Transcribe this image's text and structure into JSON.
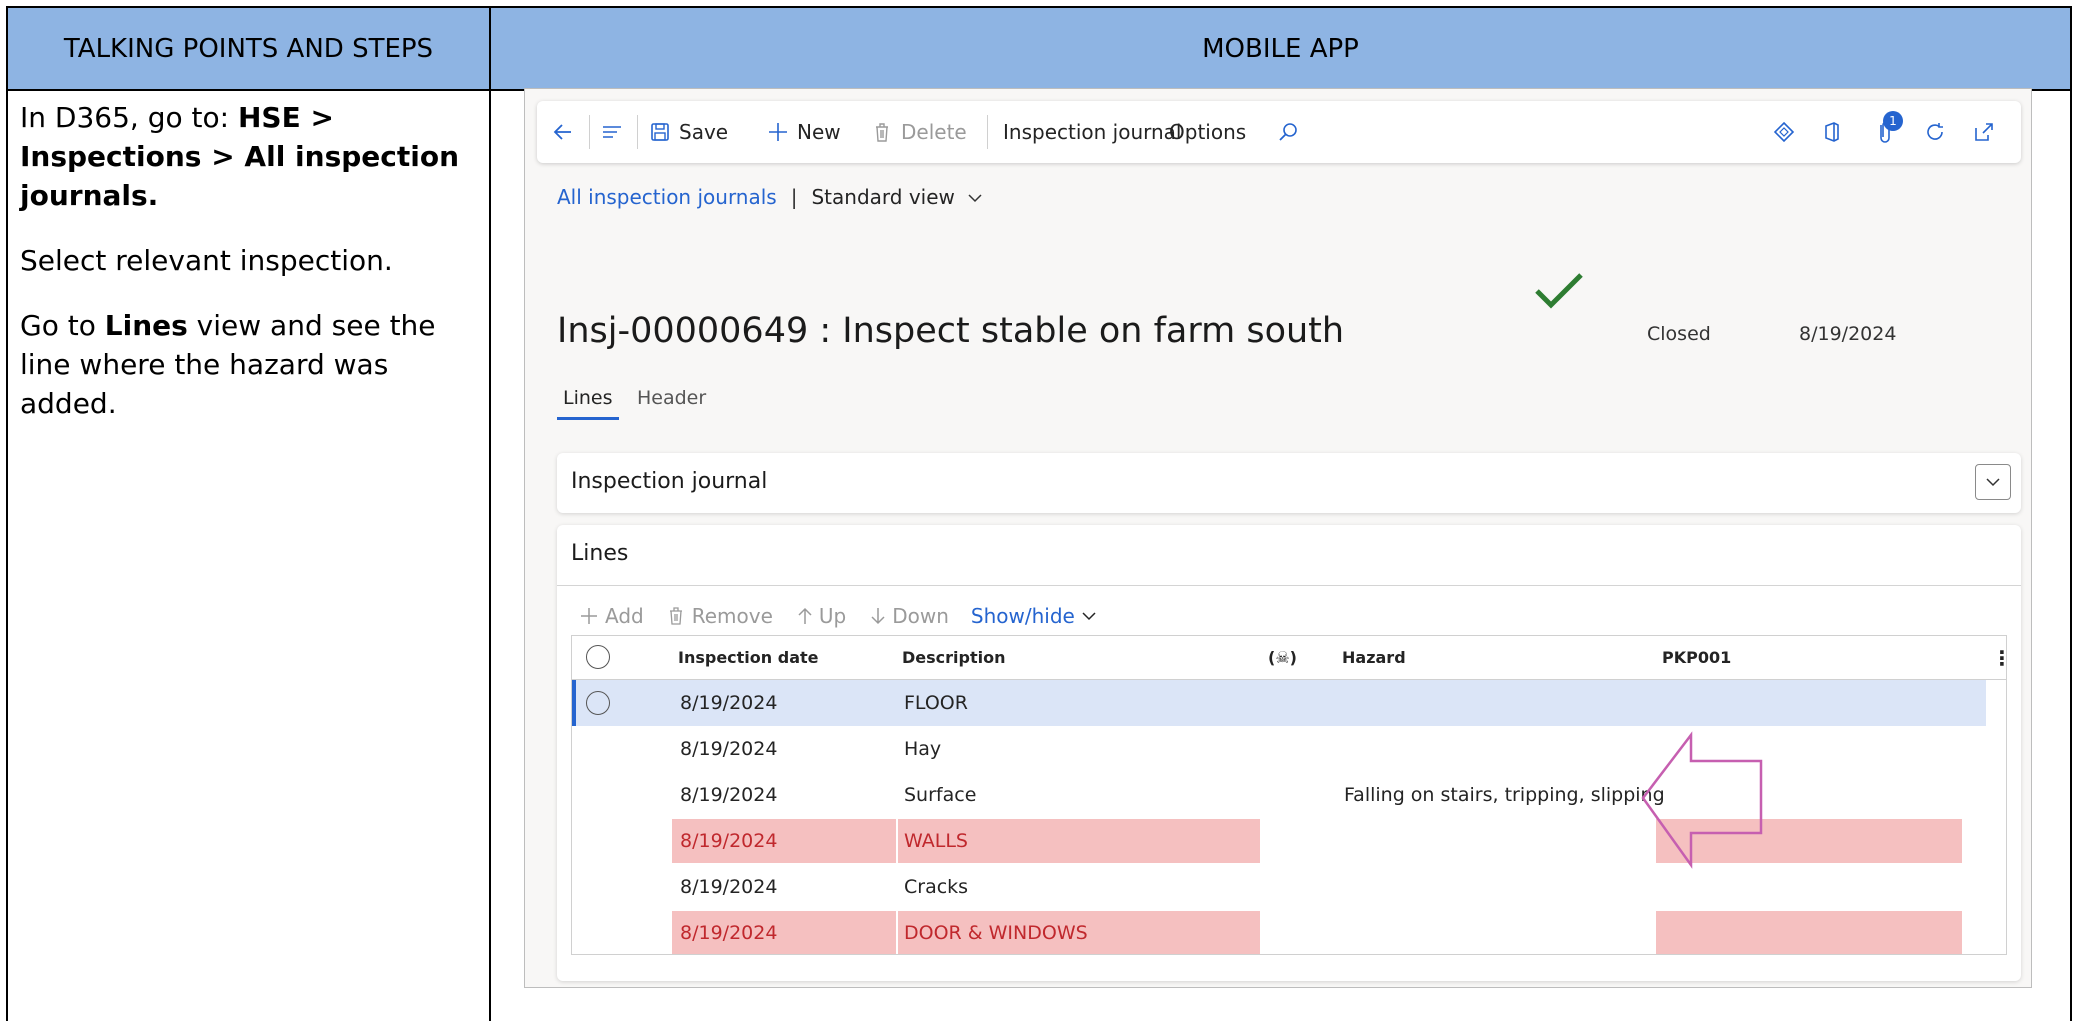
{
  "doc": {
    "headers": [
      "TALKING POINTS AND STEPS",
      "MOBILE APP"
    ],
    "steps": {
      "nav_prefix": "In D365, go to: ",
      "nav_path": "HSE > Inspections > All inspection journals.",
      "select": "Select relevant inspection.",
      "go_to": "Go to ",
      "lines_word": "Lines",
      "rest": " view and see the line where the hazard was added."
    }
  },
  "toolbar": {
    "save": "Save",
    "new": "New",
    "delete": "Delete",
    "inspection_journal": "Inspection journal",
    "options": "Options",
    "badge_count": "1"
  },
  "breadcrumb": {
    "link": "All inspection journals",
    "separator": "|",
    "view": "Standard view"
  },
  "record": {
    "title": "Insj-00000649 : Inspect stable on farm south",
    "status": "Closed",
    "date": "8/19/2024"
  },
  "tabs": [
    "Lines",
    "Header"
  ],
  "sections": {
    "inspection_journal": "Inspection journal",
    "lines": "Lines"
  },
  "lines_toolbar": {
    "add": "Add",
    "remove": "Remove",
    "up": "Up",
    "down": "Down",
    "show_hide": "Show/hide"
  },
  "grid": {
    "columns": [
      "Inspection date",
      "Description",
      "(☠)",
      "Hazard",
      "PKP001"
    ],
    "rows": [
      {
        "date": "8/19/2024",
        "description": "FLOOR",
        "hazard": "",
        "state": "selected"
      },
      {
        "date": "8/19/2024",
        "description": "Hay",
        "hazard": "",
        "state": "normal"
      },
      {
        "date": "8/19/2024",
        "description": "Surface",
        "hazard": "Falling on stairs, tripping, slipping",
        "state": "normal"
      },
      {
        "date": "8/19/2024",
        "description": "WALLS",
        "hazard": "",
        "state": "red"
      },
      {
        "date": "8/19/2024",
        "description": "Cracks",
        "hazard": "",
        "state": "normal"
      },
      {
        "date": "8/19/2024",
        "description": "DOOR & WINDOWS",
        "hazard": "",
        "state": "red"
      }
    ]
  },
  "colors": {
    "header_bg": "#8eb4e3",
    "accent": "#2564cf",
    "highlight": "#f5c0c0",
    "highlight_text": "#c0282d",
    "check": "#2e7d32",
    "arrow": "#c65fb0"
  }
}
